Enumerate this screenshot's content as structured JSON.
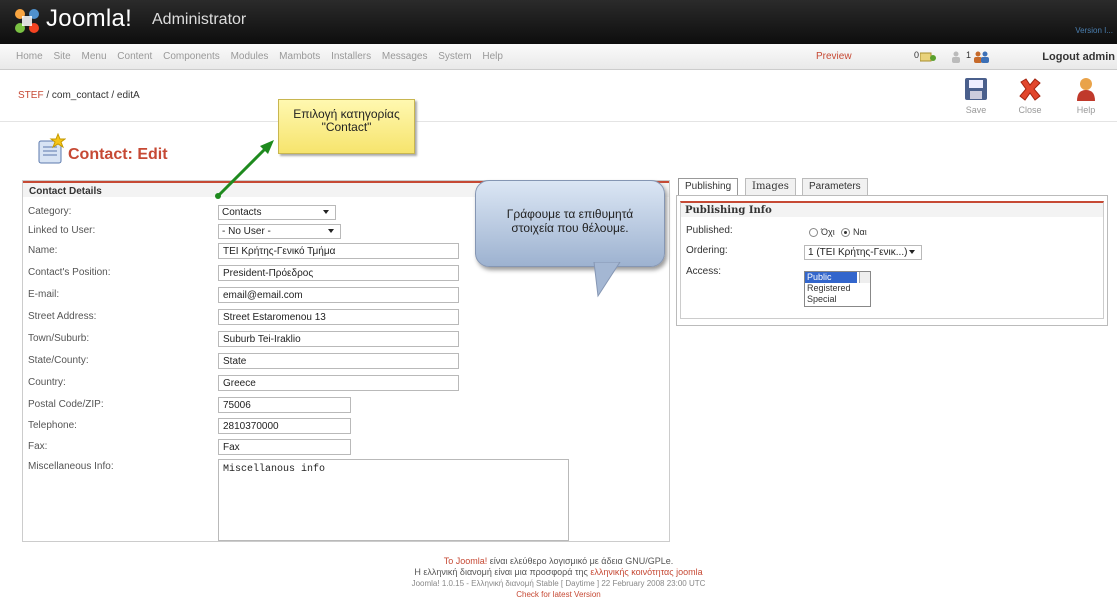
{
  "header": {
    "logo_text": "Joomla!",
    "logo_suffix": "Administrator",
    "version_text": "Version I..."
  },
  "menu": {
    "items": [
      "Home",
      "Site",
      "Menu",
      "Content",
      "Components",
      "Modules",
      "Mambots",
      "Installers",
      "Messages",
      "System",
      "Help"
    ],
    "preview": "Preview",
    "messages_count": "0",
    "users_count": "1",
    "logout": "Logout admin"
  },
  "breadcrumb": {
    "site": "STEF",
    "path": " / com_contact / editA"
  },
  "toolbar": {
    "save": "Save",
    "close": "Close",
    "help": "Help"
  },
  "page_title": "Contact: Edit",
  "details": {
    "heading": "Contact Details",
    "category": {
      "label": "Category:",
      "value": "Contacts"
    },
    "linked_user": {
      "label": "Linked to User:",
      "value": "- No User -"
    },
    "name": {
      "label": "Name:",
      "value": "ΤΕΙ Κρήτης-Γενικό Τμήμα"
    },
    "position": {
      "label": "Contact's Position:",
      "value": "President-Πρόεδρος"
    },
    "email": {
      "label": "E-mail:",
      "value": "email@email.com"
    },
    "street": {
      "label": "Street Address:",
      "value": "Street Estaromenou 13"
    },
    "town": {
      "label": "Town/Suburb:",
      "value": "Suburb Tei-Iraklio"
    },
    "state": {
      "label": "State/County:",
      "value": "State"
    },
    "country": {
      "label": "Country:",
      "value": "Greece"
    },
    "postal": {
      "label": "Postal Code/ZIP:",
      "value": "75006"
    },
    "telephone": {
      "label": "Telephone:",
      "value": "2810370000"
    },
    "fax": {
      "label": "Fax:",
      "value": "Fax"
    },
    "misc": {
      "label": "Miscellaneous Info:",
      "value": "Miscellanous info"
    }
  },
  "tabs": [
    "Publishing",
    "Images",
    "Parameters"
  ],
  "publishing": {
    "heading": "Publishing Info",
    "published_label": "Published:",
    "option_no": "Όχι",
    "option_yes": "Ναι",
    "ordering_label": "Ordering:",
    "ordering_value": "1 (ΤΕΙ Κρήτης-Γενικ...)",
    "access_label": "Access:",
    "access_options": [
      "Public",
      "Registered",
      "Special"
    ],
    "access_selected": "Public"
  },
  "callouts": {
    "category_note_line1": "Επιλογή κατηγορίας",
    "category_note_line2": "\"Contact\"",
    "fill_note_line1": "Γράφουμε τα επιθυμητά",
    "fill_note_line2": "στοιχεία που θέλουμε."
  },
  "footer": {
    "joomla_link": "Το Joomla!",
    "line1_rest": " είναι ελεύθερο λογισμικό με άδεια GNU/GPLe.",
    "line2_start": "Η ελληνική διανομή είναι μια προσφορά της ",
    "line2_link": "ελληνικής κοινότητας joomla",
    "line3": "Joomla! 1.0.15 - Ελληνική διανομή Stable [ Daytime ] 22 February 2008 23:00 UTC",
    "check_version": "Check for latest Version"
  },
  "colors": {
    "accent": "#c64934",
    "header_bg": "#111111",
    "note_yellow": "#f6e46d",
    "note_blue": "#9db2d0"
  }
}
